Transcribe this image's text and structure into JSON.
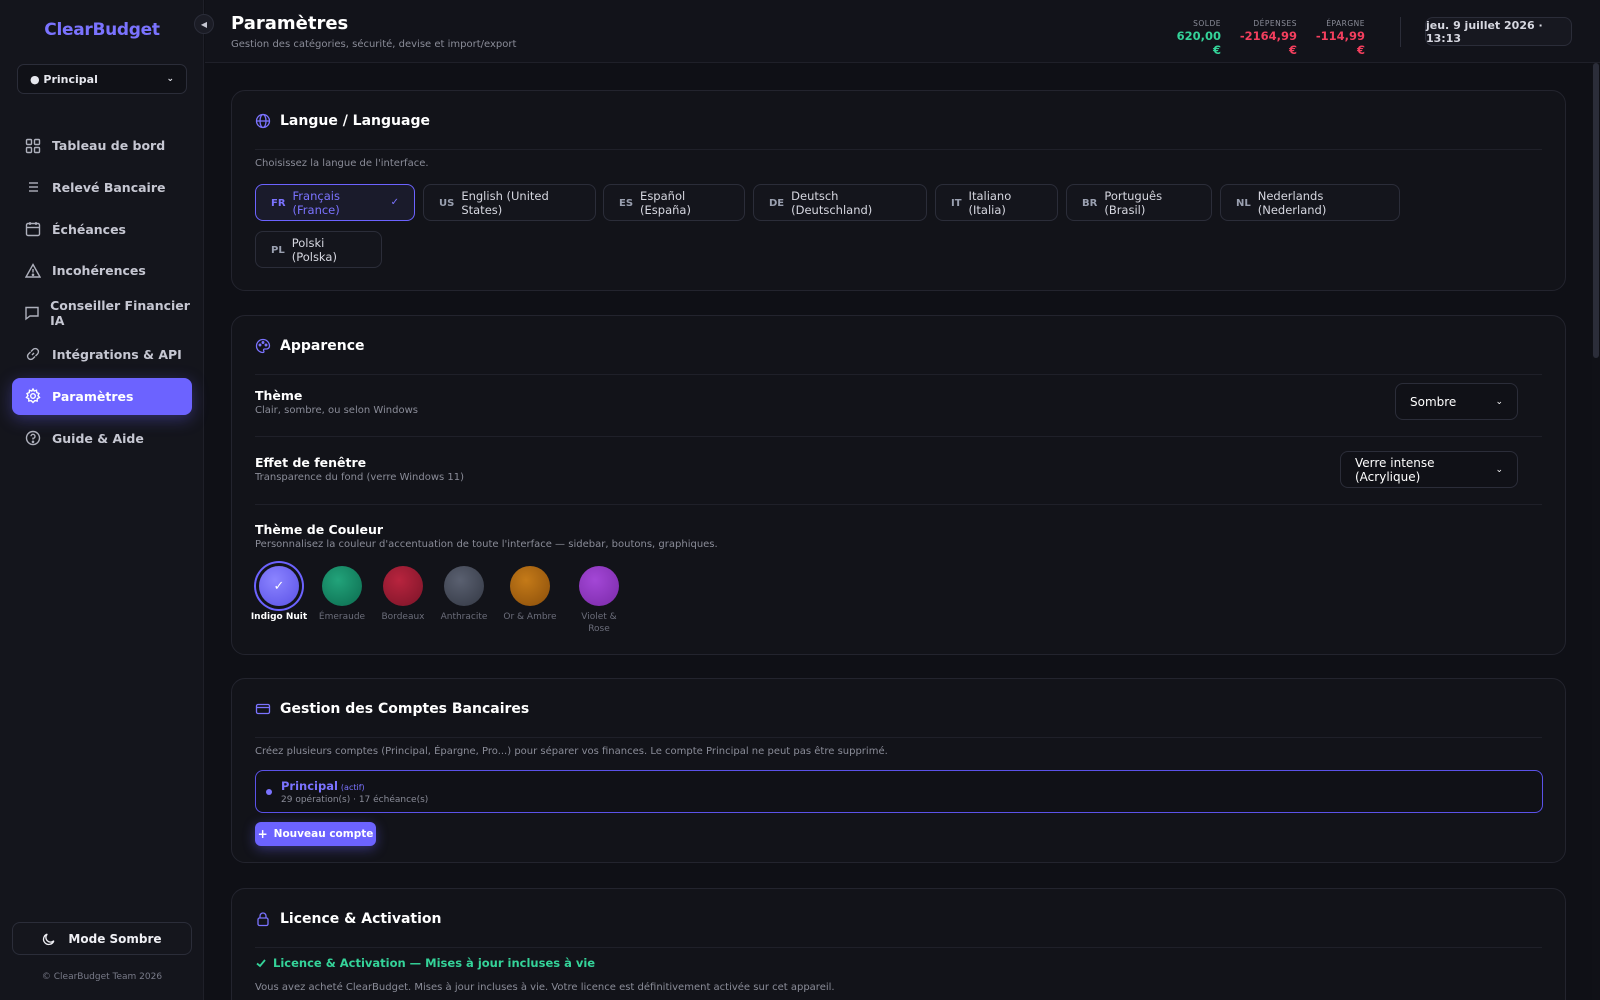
{
  "sidebar": {
    "brand": "ClearBudget",
    "account_select": "● Principal",
    "items": [
      {
        "label": "Tableau de bord",
        "icon": "dashboard-icon"
      },
      {
        "label": "Relevé Bancaire",
        "icon": "list-icon"
      },
      {
        "label": "Échéances",
        "icon": "calendar-icon"
      },
      {
        "label": "Incohérences",
        "icon": "warning-icon"
      },
      {
        "label": "Conseiller Financier IA",
        "icon": "chat-icon"
      },
      {
        "label": "Intégrations & API",
        "icon": "link-icon"
      },
      {
        "label": "Paramètres",
        "icon": "gear-icon",
        "active": true
      },
      {
        "label": "Guide & Aide",
        "icon": "help-icon"
      }
    ],
    "mode_button": "Mode Sombre",
    "copyright": "© ClearBudget Team 2026"
  },
  "header": {
    "title": "Paramètres",
    "subtitle": "Gestion des catégories, sécurité, devise et import/export",
    "stats": [
      {
        "label": "SOLDE",
        "value": "620,00 €",
        "color": "#34d399"
      },
      {
        "label": "DÉPENSES",
        "value": "-2164,99 €",
        "color": "#f43f5e"
      },
      {
        "label": "ÉPARGNE",
        "value": "-114,99 €",
        "color": "#f43f5e"
      }
    ],
    "datetime": "jeu. 9 juillet 2026 · 13:13"
  },
  "language": {
    "title": "Langue / Language",
    "description": "Choisissez la langue de l'interface.",
    "options": [
      {
        "code": "FR",
        "label": "Français (France)",
        "selected": true
      },
      {
        "code": "US",
        "label": "English (United States)"
      },
      {
        "code": "ES",
        "label": "Español (España)"
      },
      {
        "code": "DE",
        "label": "Deutsch (Deutschland)"
      },
      {
        "code": "IT",
        "label": "Italiano (Italia)"
      },
      {
        "code": "BR",
        "label": "Português (Brasil)"
      },
      {
        "code": "NL",
        "label": "Nederlands (Nederland)"
      },
      {
        "code": "PL",
        "label": "Polski (Polska)"
      }
    ]
  },
  "appearance": {
    "title": "Apparence",
    "theme": {
      "label": "Thème",
      "sub": "Clair, sombre, ou selon Windows",
      "value": "Sombre"
    },
    "window_effect": {
      "label": "Effet de fenêtre",
      "sub": "Transparence du fond (verre Windows 11)",
      "value": "Verre intense (Acrylique)"
    },
    "color_theme": {
      "label": "Thème de Couleur",
      "sub": "Personnalisez la couleur d'accentuation de toute l'interface — sidebar, boutons, graphiques.",
      "swatches": [
        {
          "name": "Indigo Nuit",
          "color": "#6c63ff",
          "active": true
        },
        {
          "name": "Émeraude",
          "color": "#10b981"
        },
        {
          "name": "Bordeaux",
          "color": "#be123c"
        },
        {
          "name": "Anthracite",
          "color": "#475569"
        },
        {
          "name": "Or & Ambre",
          "color": "#d97706"
        },
        {
          "name": "Violet & Rose",
          "color": "#a855f7"
        }
      ]
    }
  },
  "accounts": {
    "title": "Gestion des Comptes Bancaires",
    "description": "Créez plusieurs comptes (Principal, Épargne, Pro...) pour séparer vos finances. Le compte Principal ne peut pas être supprimé.",
    "items": [
      {
        "name": "Principal",
        "tag": "(actif)",
        "meta": "29 opération(s) · 17 échéance(s)"
      }
    ],
    "new_button": "Nouveau compte"
  },
  "license": {
    "title": "Licence & Activation",
    "status": "Licence & Activation — Mises à jour incluses à vie",
    "text": "Vous avez acheté ClearBudget. Mises à jour incluses à vie. Votre licence est définitivement activée sur cet appareil."
  }
}
